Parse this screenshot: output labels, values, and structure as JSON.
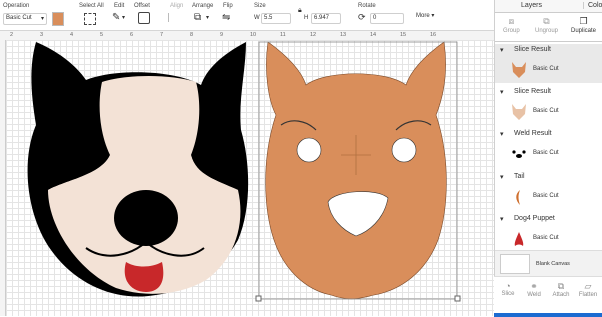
{
  "toolbar": {
    "operation_label": "Operation",
    "operation_value": "Basic Cut",
    "swatch_color": "#d98e5b",
    "select_all": "Select All",
    "edit": "Edit",
    "offset": "Offset",
    "align": "Align",
    "arrange": "Arrange",
    "flip": "Flip",
    "size": "Size",
    "w_label": "W",
    "w_value": "5.5",
    "h_label": "H",
    "h_value": "6.947",
    "rotate": "Rotate",
    "rotate_value": "0",
    "more": "More"
  },
  "ruler": {
    "ticks": [
      "2",
      "3",
      "4",
      "5",
      "6",
      "7",
      "8",
      "9",
      "10",
      "11",
      "12",
      "13",
      "14",
      "15",
      "16"
    ]
  },
  "layers_panel": {
    "tab_layers": "Layers",
    "tab_color": "Colo",
    "group": "Group",
    "ungroup": "Ungroup",
    "duplicate": "Duplicate",
    "items": [
      {
        "title": "Slice Result",
        "child": "Basic Cut",
        "color": "#d98e5b"
      },
      {
        "title": "Slice Result",
        "child": "Basic Cut",
        "color": "#e8c2a6"
      },
      {
        "title": "Weld Result",
        "child": "Basic Cut",
        "color": "#000000"
      },
      {
        "title": "Tail",
        "child": "Basic Cut",
        "color": "#cf6f2e"
      },
      {
        "title": "Dog4 Puppet",
        "child": "Basic Cut",
        "color": "#c8282a"
      }
    ],
    "blank_canvas": "Blank Canvas",
    "bottom": [
      "Slice",
      "Weld",
      "Attach",
      "Flatten"
    ]
  },
  "colors": {
    "dog_orange": "#d98e5b",
    "dog_black": "#000000",
    "dog_cream": "#f3e2d6",
    "tongue": "#c8282a",
    "selected_row": "#e9e9e9"
  }
}
